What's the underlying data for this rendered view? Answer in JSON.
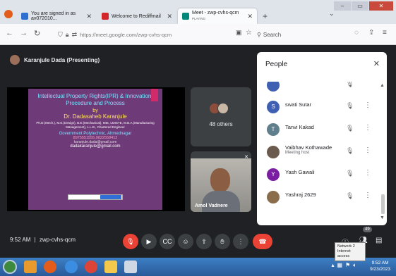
{
  "browser": {
    "tabs": [
      {
        "title": "You are signed in as av072010..."
      },
      {
        "title": "Welcome to Rediffmail"
      },
      {
        "title": "Meet - zwp-cvhs-qcm",
        "sub": "PLAYING"
      }
    ],
    "new_tab": "+",
    "url": "https://meet.google.com/zwp-cvhs-qcm",
    "search_placeholder": "Search"
  },
  "meet": {
    "presenter_label": "Karanjule Dada (Presenting)",
    "slide": {
      "title": "Intellectual Property Rights(IPR) & Innovation: Procedure and Process",
      "by": "by",
      "name": "Dr. Dadasaheb Karanjule",
      "degrees": "Ph.D.(Mech.), M.E.(Design), B.E.(Mechanical), MIE, LMISTE, M.B.A.(Manufacturing Management), L.L.B., Chartered Engineer",
      "college": "Government Polytechnic, Ahmednagar",
      "phone": "8975551555,9822558412",
      "email1": "karanjule.dada@gmail.com",
      "email2": "dadakaranjule@gmail.com"
    },
    "others_label": "48 others",
    "camera_name": "Amol Vadnere",
    "time": "9:52 AM",
    "separator": "|",
    "meeting_code": "zwp-cvhs-qcm",
    "participant_count": "49",
    "tooltip_line1": "Network 2",
    "tooltip_line2": "Internet access"
  },
  "people": {
    "title": "People",
    "participants": [
      {
        "name": "swati Sutar",
        "initial": "S",
        "color": "#3f5fb3",
        "sub": ""
      },
      {
        "name": "Tanvi Kakad",
        "initial": "T",
        "color": "#5f7f8c",
        "sub": ""
      },
      {
        "name": "Vaibhav Kothawade",
        "initial": "",
        "color": "#6b5a4e",
        "sub": "Meeting host"
      },
      {
        "name": "Yash Gawali",
        "initial": "Y",
        "color": "#7b1fa2",
        "sub": ""
      },
      {
        "name": "Yashraj 2629",
        "initial": "",
        "color": "#8a6d4b",
        "sub": ""
      }
    ]
  },
  "taskbar": {
    "clock_time": "9:52 AM",
    "clock_date": "9/23/2023"
  }
}
